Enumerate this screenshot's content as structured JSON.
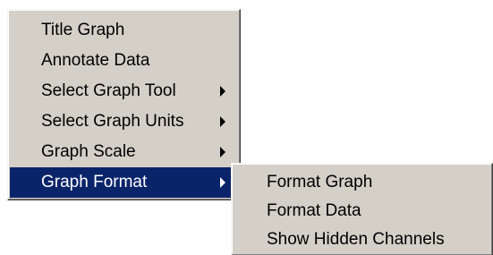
{
  "colors": {
    "menu_background": "#d4d0c8",
    "selection_background": "#0a246a",
    "selection_text": "#ffffff",
    "text": "#000000"
  },
  "menu": {
    "items": [
      {
        "label": "Title Graph",
        "submenu": false
      },
      {
        "label": "Annotate Data",
        "submenu": false
      },
      {
        "label": "Select Graph Tool",
        "submenu": true,
        "icon": "chevron-right-icon"
      },
      {
        "label": "Select Graph Units",
        "submenu": true,
        "icon": "chevron-right-icon"
      },
      {
        "label": "Graph Scale",
        "submenu": true,
        "icon": "chevron-right-icon"
      },
      {
        "label": "Graph Format",
        "submenu": true,
        "icon": "chevron-right-icon",
        "selected": true
      }
    ]
  },
  "submenu": {
    "parent": "Graph Format",
    "items": [
      {
        "label": "Format Graph"
      },
      {
        "label": "Format Data"
      },
      {
        "label": "Show Hidden Channels"
      }
    ]
  }
}
